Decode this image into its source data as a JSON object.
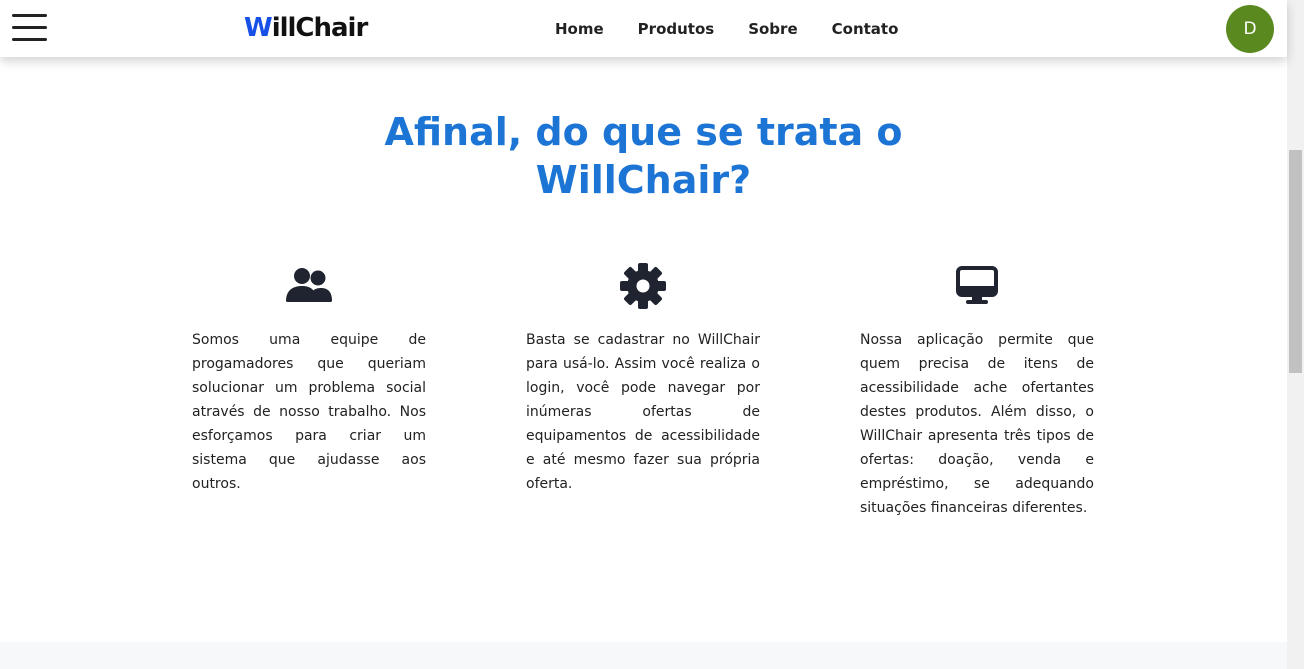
{
  "navbar": {
    "logo_first_letter": "W",
    "logo_rest": "illChair",
    "links": [
      "Home",
      "Produtos",
      "Sobre",
      "Contato"
    ],
    "avatar_initial": "D",
    "menu_icon": "hamburger-menu-icon"
  },
  "section": {
    "title_line1": "Afinal, do que se trata o",
    "title_line2": "WillChair?",
    "features": [
      {
        "icon": "users-icon",
        "text": "Somos uma equipe de progamadores que queriam solucionar um problema social através de nosso trabalho. Nos esforçamos para criar um sistema que ajudasse aos outros."
      },
      {
        "icon": "gear-icon",
        "text": "Basta se cadastrar no WillChair para usá-lo. Assim você realiza o login, você pode navegar por inúmeras ofertas de equipamentos de acessibilidade e até mesmo fazer sua própria oferta."
      },
      {
        "icon": "desktop-icon",
        "text": "Nossa aplicação permite que quem precisa de itens de acessibilidade ache ofertantes destes produtos. Além disso, o WillChair apresenta três tipos de ofertas: doação, venda e empréstimo, se adequando situações financeiras diferentes."
      }
    ]
  },
  "colors": {
    "heading": "#1c74d4",
    "logo_accent": "#1650e6",
    "avatar_bg": "#5a8a1f",
    "icon": "#1f2430"
  }
}
